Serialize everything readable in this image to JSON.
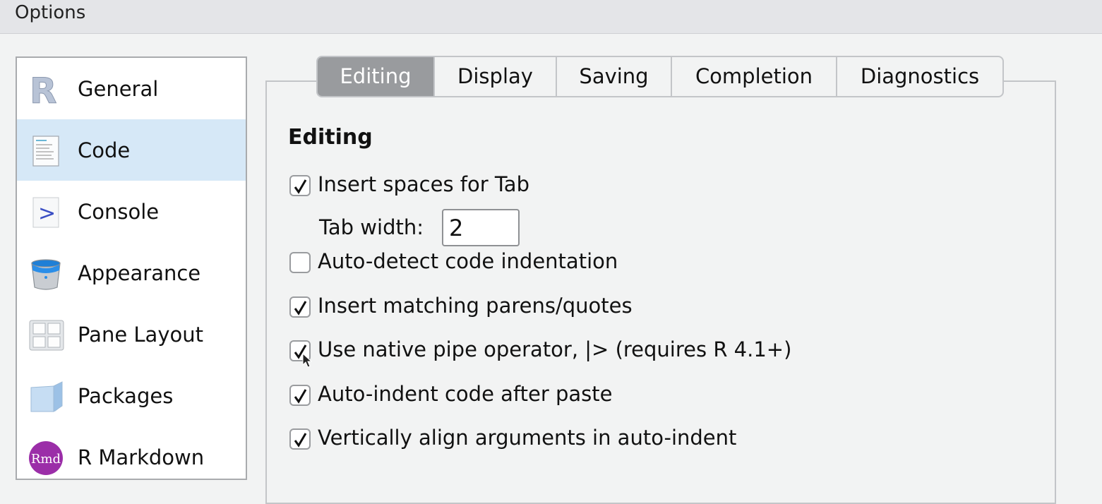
{
  "window": {
    "title": "Options"
  },
  "sidebar": {
    "items": [
      {
        "label": "General",
        "icon": "r-logo-icon",
        "selected": false
      },
      {
        "label": "Code",
        "icon": "code-document-icon",
        "selected": true
      },
      {
        "label": "Console",
        "icon": "console-prompt-icon",
        "selected": false
      },
      {
        "label": "Appearance",
        "icon": "paint-bucket-icon",
        "selected": false
      },
      {
        "label": "Pane Layout",
        "icon": "pane-grid-icon",
        "selected": false
      },
      {
        "label": "Packages",
        "icon": "package-box-icon",
        "selected": false
      },
      {
        "label": "R Markdown",
        "icon": "rmd-logo-icon",
        "selected": false
      }
    ]
  },
  "tabs": [
    {
      "label": "Editing",
      "active": true
    },
    {
      "label": "Display",
      "active": false
    },
    {
      "label": "Saving",
      "active": false
    },
    {
      "label": "Completion",
      "active": false
    },
    {
      "label": "Diagnostics",
      "active": false
    }
  ],
  "editing": {
    "section_title": "Editing",
    "options": [
      {
        "label": "Insert spaces for Tab",
        "checked": true
      },
      {
        "label": "Auto-detect code indentation",
        "checked": false
      },
      {
        "label": "Insert matching parens/quotes",
        "checked": true
      },
      {
        "label": "Use native pipe operator, |> (requires R 4.1+)",
        "checked": true
      },
      {
        "label": "Auto-indent code after paste",
        "checked": true
      },
      {
        "label": "Vertically align arguments in auto-indent",
        "checked": true
      }
    ],
    "tab_width": {
      "label": "Tab width:",
      "value": "2"
    }
  },
  "colors": {
    "selected_sidebar": "#d6e8f7",
    "active_tab": "#999b9e",
    "console_prompt": "#3b4fc4",
    "rmd_purple": "#9b2ea8"
  }
}
